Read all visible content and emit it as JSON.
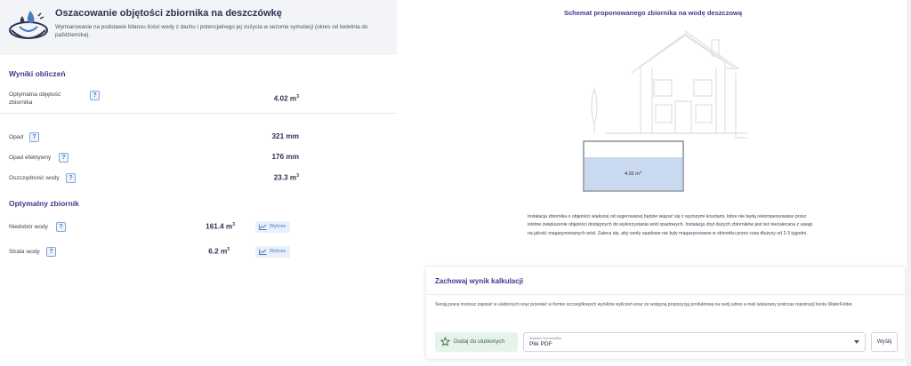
{
  "header": {
    "title": "Oszacowanie objętości zbiornika na deszczówkę",
    "description": "Wymiarowanie na podstawie bilansu ilości wody z dachu i potencjalnego jej zużycia w sezonie symulacji (okres od kwietnia do października)."
  },
  "results": {
    "section_title": "Wyniki obliczeń",
    "rows": [
      {
        "label": "Optymalna objętość zbiornika",
        "value": "4.02 m",
        "unit_sup": "3"
      },
      {
        "label": "Opad",
        "value": "321 mm"
      },
      {
        "label": "Opad efektywny",
        "value": "176 mm"
      },
      {
        "label": "Oszczędność wody",
        "value": "23.3 m",
        "unit_sup": "3"
      }
    ]
  },
  "optimal": {
    "section_title": "Optymalny zbiornik",
    "rows": [
      {
        "label": "Niedobór wody",
        "value": "161.4 m",
        "unit_sup": "3",
        "button": "Wykres"
      },
      {
        "label": "Strata wody",
        "value": "6.2 m",
        "unit_sup": "3",
        "button": "Wykres"
      }
    ]
  },
  "help_glyph": "?",
  "schematic": {
    "title": "Schemat proponowanego zbiornika na wodę deszczową",
    "tank_label": "4.02 m",
    "tank_sup": "3",
    "note": "Instalacja zbiornika o objętości większej od sugerowanej będzie wiązać się z wyższymi kosztami, które nie będą rekompensowane przez istotne zwiększenie objętości dostępnych do wykorzystania wód opadowych. Instalacja zbyt dużych zbiorników jest też niezalecana z uwagi na jakość magazynowanych wód. Zaleca się, aby wody opadowe nie były magazynowane w zbiorniku przez czas dłuższy od 2-3 tygodni."
  },
  "save": {
    "title": "Zachowaj wynik kalkulacji",
    "description": "Swoją pracę możesz zapisać w ulubionych oraz przesłać w formie szczegółowych wyników wyliczeń wraz ze wstępną propozycją produktową na swój adres e-mail wskazany podczas rejestracji konta WaterFolder.",
    "favorite_button": "Dodaj do ulubionych",
    "format_label": "Wybierz format pliku",
    "format_value": "Plik PDF",
    "send_button": "Wyślij"
  },
  "colors": {
    "accent": "#3b3a8f",
    "link_blue": "#4a7cc0",
    "water": "#c9d9ef"
  }
}
